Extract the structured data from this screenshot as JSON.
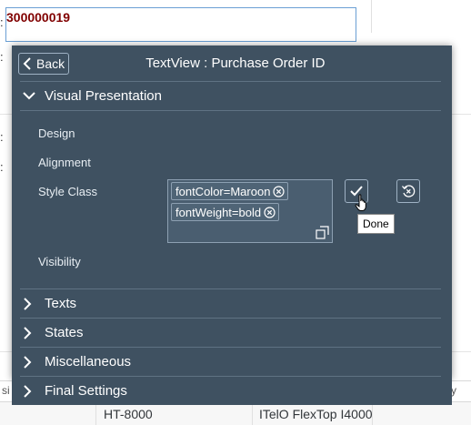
{
  "background": {
    "input_value": "300000019",
    "colon": ":",
    "table_cells": {
      "product_id": "HT-8000",
      "product_name": "ITelO FlexTop I4000",
      "left_fragment": "si",
      "right_fragment": "y"
    }
  },
  "popover": {
    "back_label": "Back",
    "title": "TextView : Purchase Order ID",
    "sections": {
      "visual": "Visual Presentation",
      "texts": "Texts",
      "states": "States",
      "misc": "Miscellaneous",
      "final": "Final Settings"
    },
    "properties": {
      "design": "Design",
      "alignment": "Alignment",
      "style_class": "Style Class",
      "visibility": "Visibility"
    },
    "style_tokens": [
      "fontColor=Maroon",
      "fontWeight=bold"
    ],
    "done_tooltip": "Done"
  },
  "colors": {
    "popover_bg": "#3f5161",
    "value_text": "#800000",
    "input_border": "#6a9fd4"
  }
}
